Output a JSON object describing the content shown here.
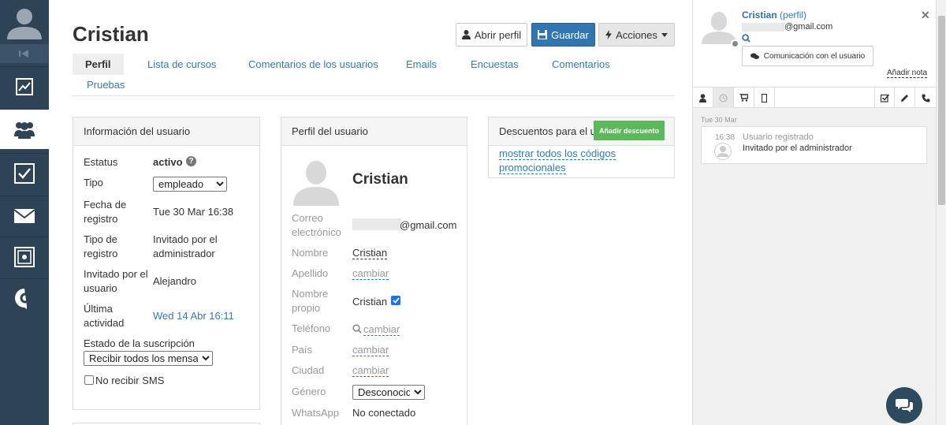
{
  "sidebar": {
    "items": [
      {
        "icon": "chart-icon"
      },
      {
        "icon": "users-icon",
        "active": true
      },
      {
        "icon": "checkbox-icon"
      },
      {
        "icon": "mail-icon"
      },
      {
        "icon": "safe-icon"
      },
      {
        "icon": "c-logo-icon"
      }
    ]
  },
  "header": {
    "title": "Cristian",
    "open_profile": "Abrir perfil",
    "save": "Guardar",
    "actions": "Acciones"
  },
  "tabs": [
    "Perfil",
    "Lista de cursos",
    "Comentarios de los usuarios",
    "Emails",
    "Encuestas",
    "Comentarios",
    "Pruebas"
  ],
  "info": {
    "heading": "Información del usuario",
    "status_label": "Estatus",
    "status_value": "activo",
    "type_label": "Tipo",
    "type_value": "empleado",
    "reg_date_label_1": "Fecha de",
    "reg_date_label_2": "registro",
    "reg_date_value": "Tue 30 Mar 16:38",
    "reg_type_label_1": "Tipo de",
    "reg_type_label_2": "registro",
    "reg_type_value_1": "Invitado por el",
    "reg_type_value_2": "administrador",
    "invited_label_1": "Invitado por el",
    "invited_label_2": "usuario",
    "invited_value": "Alejandro",
    "last_label_1": "Última",
    "last_label_2": "actividad",
    "last_value": "Wed 14 Abr 16:11",
    "sub_label": "Estado de la suscripción",
    "sub_value": "Recibir todos los mensajes",
    "no_sms": "No recibir SMS"
  },
  "profile": {
    "heading": "Perfil del usuario",
    "name": "Cristian",
    "email_label_1": "Correo",
    "email_label_2": "electrónico",
    "email_value": "@gmail.com",
    "first_name_label": "Nombre",
    "first_name_value": "Cristian",
    "last_name_label": "Apellido",
    "change": "cambiar",
    "own_name_label_1": "Nombre",
    "own_name_label_2": "propio",
    "own_name_value": "Cristian",
    "phone_label": "Teléfono",
    "country_label": "País",
    "city_label": "Ciudad",
    "gender_label": "Género",
    "gender_value": "Desconocido",
    "whatsapp_label": "WhatsApp",
    "whatsapp_value": "No conectado"
  },
  "discounts": {
    "heading": "Descuentos para el us",
    "add_button": "Añadir descuento",
    "link_1": "mostrar todos los códigos",
    "link_2": "promocionales"
  },
  "right_panel": {
    "name": "Cristian",
    "profile_suffix": "(perfil)",
    "email": "@gmail.com",
    "comm_button": "Comunicación con el usuario",
    "add_note": "Añadir nota",
    "date": "Tue 30 Mar",
    "event_time": "16:38",
    "event_title": "Usuario registrado",
    "event_detail": "Invitado por el administrador"
  },
  "colors": {
    "sidebar": "#2e4356",
    "primary": "#3276b1",
    "link": "#337ab7",
    "success": "#5cb85c"
  }
}
